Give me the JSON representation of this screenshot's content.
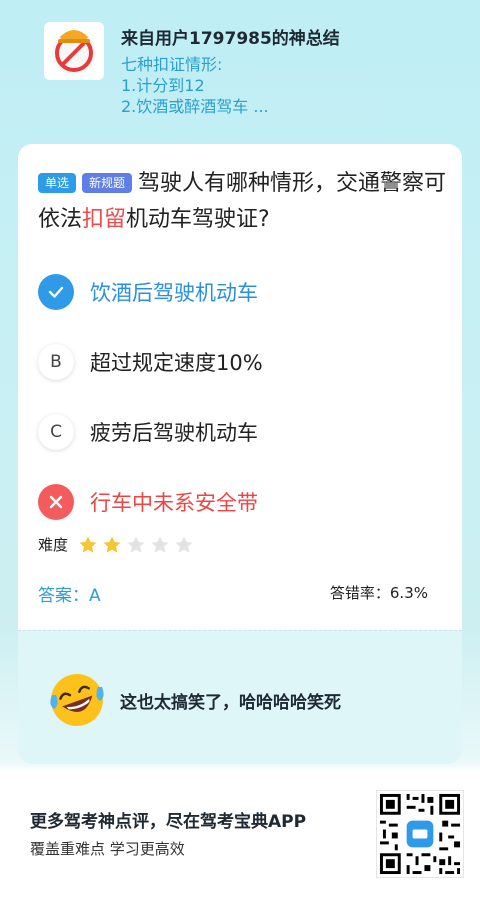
{
  "header": {
    "user_title": "来自用户1797985的神总结",
    "summary_lines": [
      "七种扣证情形:",
      "1.计分到12",
      "2.饮酒或醉酒驾车 ..."
    ]
  },
  "question": {
    "tags": [
      "单选",
      "新规题"
    ],
    "text_before": "驾驶人有哪种情形，交通警察可依法",
    "text_highlight": "扣留",
    "text_after": "机动车驾驶证?"
  },
  "options": [
    {
      "letter": "A",
      "text": "饮酒后驾驶机动车",
      "state": "correct"
    },
    {
      "letter": "B",
      "text": "超过规定速度10%",
      "state": "normal"
    },
    {
      "letter": "C",
      "text": "疲劳后驾驶机动车",
      "state": "normal"
    },
    {
      "letter": "D",
      "text": "行车中未系安全带",
      "state": "wrong"
    }
  ],
  "difficulty": {
    "label": "难度",
    "stars_filled": 2,
    "stars_total": 5
  },
  "answer_label": "答案：A",
  "error_rate_label": "答错率：",
  "error_rate_value": "6.3%",
  "comment": {
    "text": "这也太搞笑了，哈哈哈哈笑死"
  },
  "footer": {
    "promo_title": "更多驾考神点评，尽在驾考宝典APP",
    "promo_sub": "覆盖重难点 学习更高效"
  },
  "colors": {
    "accent": "#2a9fd1",
    "correct": "#2f9ae8",
    "wrong": "#f25c5c",
    "star": "#f7c531"
  }
}
